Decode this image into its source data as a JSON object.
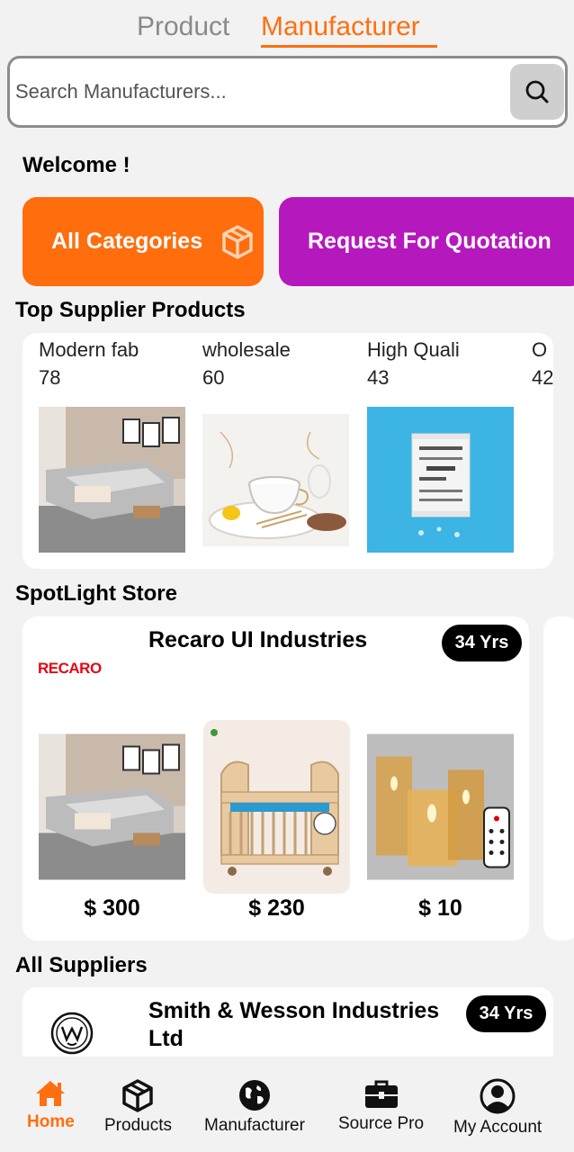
{
  "tabs": {
    "product": "Product",
    "manufacturer": "Manufacturer"
  },
  "search": {
    "placeholder": "Search Manufacturers..."
  },
  "welcome": "Welcome !",
  "categories": {
    "all": "All Categories",
    "rfq": "Request For Quotation"
  },
  "top_supplier": {
    "title": "Top Supplier Products",
    "items": [
      {
        "name": "Modern fab",
        "count": "78"
      },
      {
        "name": "wholesale",
        "count": "60"
      },
      {
        "name": "High Quali",
        "count": "43"
      },
      {
        "name": "O",
        "count": "42"
      }
    ]
  },
  "spotlight": {
    "title": "SpotLight Store",
    "store_name": "Recaro UI Industries",
    "years": "34 Yrs",
    "logo_text": "RECARO",
    "prices": [
      "$ 300",
      "$ 230",
      "$ 10"
    ]
  },
  "all_suppliers": {
    "title": "All Suppliers",
    "name": "Smith & Wesson Industries Ltd",
    "years": "34 Yrs"
  },
  "nav": {
    "home": "Home",
    "products": "Products",
    "manufacturer": "Manufacturer",
    "source_pro": "Source Pro",
    "my_account": "My Account"
  },
  "colors": {
    "accent": "#ff6f0f",
    "rfq": "#b519bd",
    "badge": "#000000"
  }
}
